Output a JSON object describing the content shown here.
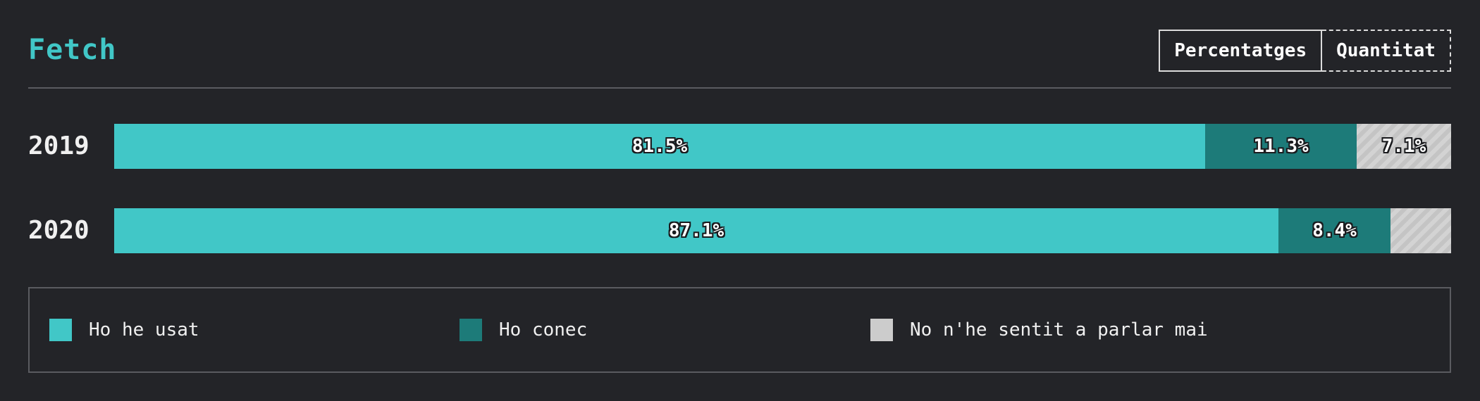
{
  "header": {
    "title": "Fetch",
    "toggle": {
      "percentages_label": "Percentatges",
      "quantity_label": "Quantitat"
    }
  },
  "colors": {
    "used": "#41c7c7",
    "known": "#1d7b79",
    "never_heard": "#cccccc",
    "title": "#41c7c7",
    "background": "#232428"
  },
  "chart_data": {
    "type": "bar",
    "orientation": "horizontal",
    "stacked": true,
    "normalized": true,
    "categories": [
      "2019",
      "2020"
    ],
    "series": [
      {
        "name": "Ho he usat",
        "values": [
          81.5,
          87.1
        ],
        "labels": [
          "81.5%",
          "87.1%"
        ]
      },
      {
        "name": "Ho conec",
        "values": [
          11.3,
          8.4
        ],
        "labels": [
          "11.3%",
          "8.4%"
        ]
      },
      {
        "name": "No n'he sentit a parlar mai",
        "values": [
          7.1,
          4.5
        ],
        "labels": [
          "7.1%",
          ""
        ]
      }
    ],
    "xlim": [
      0,
      100
    ],
    "grid": false,
    "legend_position": "bottom"
  },
  "legend": {
    "items": [
      {
        "label": "Ho he usat",
        "color": "#41c7c7"
      },
      {
        "label": "Ho conec",
        "color": "#1d7b79"
      },
      {
        "label": "No n'he sentit a parlar mai",
        "color": "#cccccc"
      }
    ]
  }
}
